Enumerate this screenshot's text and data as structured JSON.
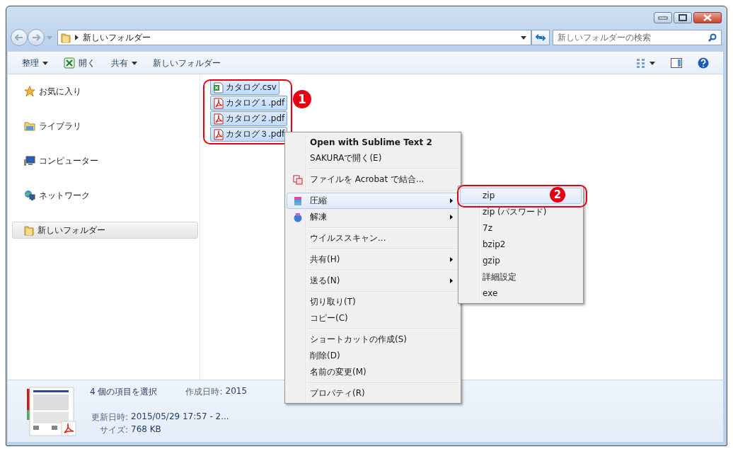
{
  "address_bar": {
    "path": "新しいフォルダー"
  },
  "search": {
    "placeholder": "新しいフォルダーの検索"
  },
  "toolbar": [
    {
      "label": "整理",
      "kind": "dropdown"
    },
    {
      "label": "開く",
      "kind": "open"
    },
    {
      "label": "共有",
      "kind": "dropdown"
    },
    {
      "label": "新しいフォルダー",
      "kind": "plain"
    }
  ],
  "sidebar": {
    "items": [
      {
        "label": "お気に入り",
        "kind": "favorites",
        "selected": false
      },
      {
        "label": "ライブラリ",
        "kind": "library",
        "selected": false
      },
      {
        "label": "コンピューター",
        "kind": "computer",
        "selected": false
      },
      {
        "label": "ネットワーク",
        "kind": "network",
        "selected": false
      },
      {
        "label": "新しいフォルダー",
        "kind": "folder",
        "selected": true
      }
    ]
  },
  "files": [
    {
      "name": "カタログ.csv",
      "kind": "csv",
      "selected": true
    },
    {
      "name": "カタログ１.pdf",
      "kind": "pdf",
      "selected": true
    },
    {
      "name": "カタログ２.pdf",
      "kind": "pdf",
      "selected": true
    },
    {
      "name": "カタログ３.pdf",
      "kind": "pdf",
      "selected": true
    }
  ],
  "context_menu": {
    "groups": [
      [
        {
          "label": "Open with Sublime Text 2",
          "kind": "plain",
          "bold": true,
          "submenu": false,
          "selected": false
        },
        {
          "label": "SAKURAで開く(E)",
          "kind": "plain",
          "bold": false,
          "submenu": false,
          "selected": false
        }
      ],
      [
        {
          "label": "ファイルを Acrobat で結合...",
          "kind": "acrobat",
          "bold": false,
          "submenu": false,
          "selected": false
        }
      ],
      [
        {
          "label": "圧縮",
          "kind": "compress",
          "bold": false,
          "submenu": true,
          "selected": true
        },
        {
          "label": "解凍",
          "kind": "extract",
          "bold": false,
          "submenu": true,
          "selected": false
        }
      ],
      [
        {
          "label": "ウイルススキャン...",
          "kind": "plain",
          "bold": false,
          "submenu": false,
          "selected": false
        }
      ],
      [
        {
          "label": "共有(H)",
          "kind": "plain",
          "bold": false,
          "submenu": true,
          "selected": false
        }
      ],
      [
        {
          "label": "送る(N)",
          "kind": "plain",
          "bold": false,
          "submenu": true,
          "selected": false
        }
      ],
      [
        {
          "label": "切り取り(T)",
          "kind": "plain",
          "bold": false,
          "submenu": false,
          "selected": false
        },
        {
          "label": "コピー(C)",
          "kind": "plain",
          "bold": false,
          "submenu": false,
          "selected": false
        }
      ],
      [
        {
          "label": "ショートカットの作成(S)",
          "kind": "plain",
          "bold": false,
          "submenu": false,
          "selected": false
        },
        {
          "label": "削除(D)",
          "kind": "plain",
          "bold": false,
          "submenu": false,
          "selected": false
        },
        {
          "label": "名前の変更(M)",
          "kind": "plain",
          "bold": false,
          "submenu": false,
          "selected": false
        }
      ],
      [
        {
          "label": "プロパティ(R)",
          "kind": "plain",
          "bold": false,
          "submenu": false,
          "selected": false
        }
      ]
    ]
  },
  "submenu": {
    "items": [
      {
        "label": "zip",
        "selected": true
      },
      {
        "label": "zip (パスワード)",
        "selected": false
      },
      {
        "label": "7z",
        "selected": false
      },
      {
        "label": "bzip2",
        "selected": false
      },
      {
        "label": "gzip",
        "selected": false
      },
      {
        "label": "詳細設定",
        "selected": false
      },
      {
        "label": "exe",
        "selected": false
      }
    ]
  },
  "annotations": {
    "files_marker": "1",
    "submenu_marker": "2"
  },
  "details": {
    "title": "4 個の項目を選択",
    "fields": [
      {
        "label": "作成日時:",
        "value": "2015"
      },
      {
        "label": "更新日時:",
        "value": "2015/05/29 17:57 - 2..."
      },
      {
        "label": "サイズ:",
        "value": "768 KB"
      }
    ]
  }
}
